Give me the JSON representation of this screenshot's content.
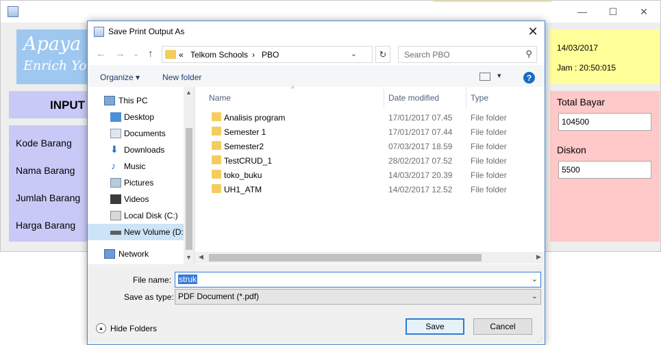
{
  "background_app": {
    "banner_line1": "Apaya",
    "banner_line2": "Enrich Yo",
    "input_heading": "INPUT",
    "fields": [
      "Kode Barang",
      "Nama Barang",
      "Jumlah Barang",
      "Harga Barang"
    ],
    "date": "14/03/2017",
    "time": "Jam : 20:50:015",
    "total_label": "Total Bayar",
    "total_value": "104500",
    "discount_label": "Diskon",
    "discount_value": "5500",
    "window_buttons": {
      "minimize": "—",
      "maximize": "☐",
      "close": "✕"
    }
  },
  "dialog": {
    "title": "Save Print Output As",
    "close_glyph": "✕",
    "nav": {
      "back": "←",
      "forward": "→",
      "recent": "⌄",
      "up": "↑"
    },
    "breadcrumb": {
      "prefix": "«",
      "parent": "Telkom Schools",
      "separator": "›",
      "current": "PBO"
    },
    "search_placeholder": "Search PBO",
    "toolbar": {
      "organize": "Organize ▾",
      "new_folder": "New folder",
      "help": "?"
    },
    "nav_pane": [
      {
        "label": "This PC",
        "icon": "computer-icon"
      },
      {
        "label": "Desktop",
        "icon": "desktop-icon"
      },
      {
        "label": "Documents",
        "icon": "documents-icon"
      },
      {
        "label": "Downloads",
        "icon": "downloads-icon"
      },
      {
        "label": "Music",
        "icon": "music-icon"
      },
      {
        "label": "Pictures",
        "icon": "pictures-icon"
      },
      {
        "label": "Videos",
        "icon": "videos-icon"
      },
      {
        "label": "Local Disk (C:)",
        "icon": "drive-icon"
      },
      {
        "label": "New Volume (D:",
        "icon": "drive-icon"
      },
      {
        "label": "Network",
        "icon": "network-icon"
      }
    ],
    "columns": {
      "name": "Name",
      "date": "Date modified",
      "type": "Type"
    },
    "files": [
      {
        "name": "Analisis program",
        "date": "17/01/2017 07.45",
        "type": "File folder"
      },
      {
        "name": "Semester 1",
        "date": "17/01/2017 07.44",
        "type": "File folder"
      },
      {
        "name": "Semester2",
        "date": "07/03/2017 18.59",
        "type": "File folder"
      },
      {
        "name": "TestCRUD_1",
        "date": "28/02/2017 07.52",
        "type": "File folder"
      },
      {
        "name": "toko_buku",
        "date": "14/03/2017 20.39",
        "type": "File folder"
      },
      {
        "name": "UH1_ATM",
        "date": "14/02/2017 12.52",
        "type": "File folder"
      }
    ],
    "file_name_label": "File name:",
    "file_name_value": "struk",
    "save_as_type_label": "Save as type:",
    "save_as_type_value": "PDF Document (*.pdf)",
    "hide_folders": "Hide Folders",
    "save_button": "Save",
    "cancel_button": "Cancel",
    "accent_color": "#2f7ad3",
    "selected_nav_color": "#cce4f7"
  }
}
